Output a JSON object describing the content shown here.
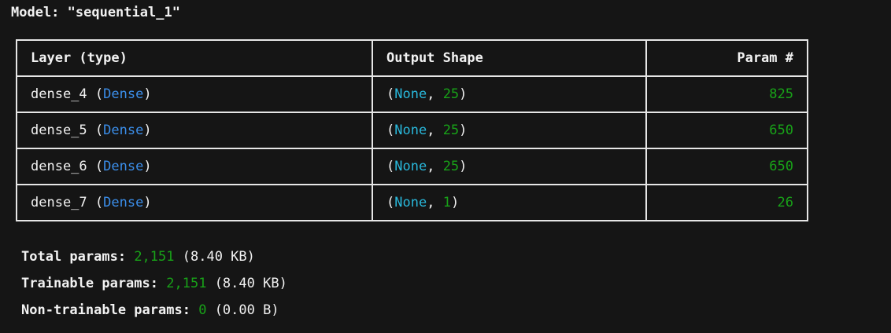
{
  "title": "Model: \"sequential_1\"",
  "headers": {
    "layer": "Layer (type)",
    "shape": "Output Shape",
    "param": "Param #"
  },
  "rows": [
    {
      "name": "dense_4",
      "type": "Dense",
      "dim0": "None",
      "dim1": "25",
      "params": "825"
    },
    {
      "name": "dense_5",
      "type": "Dense",
      "dim0": "None",
      "dim1": "25",
      "params": "650"
    },
    {
      "name": "dense_6",
      "type": "Dense",
      "dim0": "None",
      "dim1": "25",
      "params": "650"
    },
    {
      "name": "dense_7",
      "type": "Dense",
      "dim0": "None",
      "dim1": "1",
      "params": "26"
    }
  ],
  "summary": {
    "total_label": "Total params:",
    "total_value": "2,151",
    "total_size": "(8.40 KB)",
    "trainable_label": "Trainable params:",
    "trainable_value": "2,151",
    "trainable_size": "(8.40 KB)",
    "non_trainable_label": "Non-trainable params:",
    "non_trainable_value": "0",
    "non_trainable_size": "(0.00 B)"
  },
  "colors": {
    "background": "#151515",
    "text": "#f2f2f2",
    "layer_type": "#3b8eea",
    "none_keyword": "#29b8db",
    "number": "#18a218"
  }
}
